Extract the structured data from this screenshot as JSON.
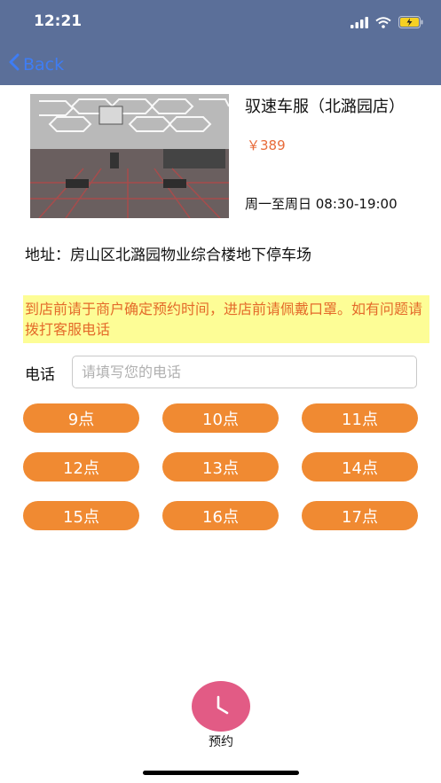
{
  "status_bar": {
    "time": "12:21"
  },
  "nav": {
    "back_label": "Back"
  },
  "shop": {
    "name": "驭速车服（北潞园店）",
    "price": "￥389",
    "hours": "周一至周日 08:30-19:00",
    "address": "地址：房山区北潞园物业综合楼地下停车场"
  },
  "notice": "到店前请于商户确定预约时间，进店前请佩戴口罩。如有问题请拨打客服电话",
  "phone": {
    "label": "电话",
    "placeholder": "请填写您的电话",
    "value": ""
  },
  "slots": [
    "9点",
    "10点",
    "11点",
    "12点",
    "13点",
    "14点",
    "15点",
    "16点",
    "17点"
  ],
  "booking": {
    "label": "预约"
  },
  "colors": {
    "nav_bg": "#5b6f99",
    "slot_bg": "#f08a32",
    "price": "#e86b3a",
    "notice_bg": "#fdfd96",
    "book_btn": "#e25b85"
  }
}
